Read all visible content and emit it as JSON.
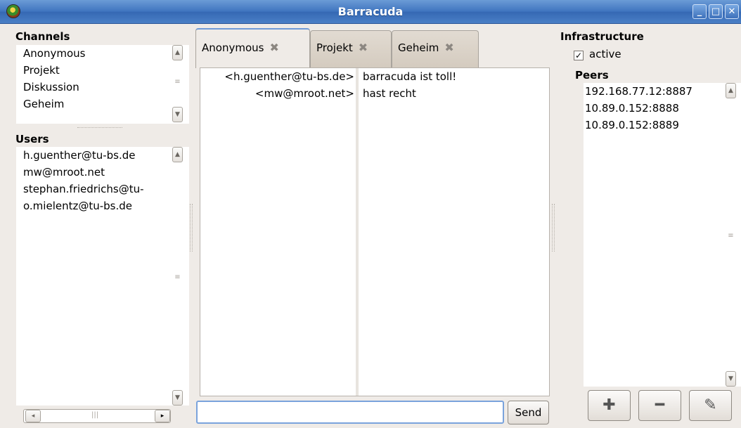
{
  "window": {
    "title": "Barracuda"
  },
  "channels": {
    "heading": "Channels",
    "items": [
      "Anonymous",
      "Projekt",
      "Diskussion",
      "Geheim"
    ]
  },
  "users": {
    "heading": "Users",
    "items": [
      "h.guenther@tu-bs.de",
      "mw@mroot.net",
      "stephan.friedrichs@tu-",
      "o.mielentz@tu-bs.de"
    ]
  },
  "tabs": [
    {
      "label": "Anonymous",
      "active": true
    },
    {
      "label": "Projekt",
      "active": false
    },
    {
      "label": "Geheim",
      "active": false
    }
  ],
  "chat": {
    "messages": [
      {
        "nick": "<h.guenther@tu-bs.de>",
        "text": "barracuda ist toll!"
      },
      {
        "nick": "<mw@mroot.net>",
        "text": "hast recht"
      }
    ],
    "input_value": "",
    "send_label": "Send"
  },
  "infrastructure": {
    "heading": "Infrastructure",
    "active_label": "active",
    "active_checked": true,
    "peers_heading": "Peers",
    "peers": [
      "192.168.77.12:8887",
      "10.89.0.152:8888",
      "10.89.0.152:8889"
    ]
  },
  "icons": {
    "tab_close": "close-x-icon",
    "add": "plus-icon",
    "remove": "minus-icon",
    "edit": "edit-icon"
  },
  "colors": {
    "titlebar": "#3f74bf",
    "focus": "#7aa3dc"
  }
}
